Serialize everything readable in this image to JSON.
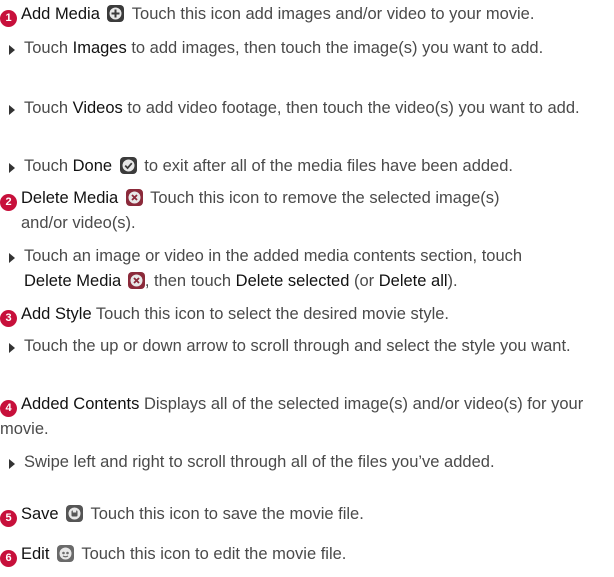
{
  "items": [
    {
      "number": "1",
      "term": "Add Media",
      "description": "Touch this icon add images and/or video to your movie.",
      "icon": "add-media-icon"
    },
    {
      "bullet_a_pre": "Touch ",
      "bullet_a_term": "Images",
      "bullet_a_post": " to add images, then touch the image(s) you want to add."
    },
    {
      "bullet_b_pre": "Touch ",
      "bullet_b_term": "Videos",
      "bullet_b_post": " to add video footage, then touch the video(s) you want to add."
    },
    {
      "bullet_c_pre": "Touch ",
      "bullet_c_term": "Done",
      "bullet_c_post": " to exit after all of the media files have been added.",
      "icon": "done-check-icon"
    }
  ],
  "delete_media": {
    "number": "2",
    "term": "Delete Media",
    "description_line1": "Touch this icon to remove the selected image(s)",
    "description_line2": "and/or video(s).",
    "icon": "delete-media-icon",
    "bullet_pre": "Touch an image or video in the added media contents section, touch",
    "bullet_term1": "Delete Media",
    "bullet_mid": ", then touch ",
    "bullet_term2": "Delete selected",
    "bullet_mid2": " (or ",
    "bullet_term3": "Delete all",
    "bullet_end": ")."
  },
  "add_style": {
    "number": "3",
    "term": "Add Style",
    "description": "Touch this icon to select the desired movie style.",
    "bullet": "Touch the up or down arrow to scroll through and select the style you want."
  },
  "added_contents": {
    "number": "4",
    "term": "Added Contents",
    "description": "Displays all of the selected image(s) and/or video(s) for your movie.",
    "bullet": "Swipe left and right to scroll through all of the files you’ve added."
  },
  "save": {
    "number": "5",
    "term": "Save",
    "description": "Touch this icon to save the movie file.",
    "icon": "save-icon"
  },
  "edit": {
    "number": "6",
    "term": "Edit",
    "description": "Touch this icon to edit the movie file.",
    "icon": "edit-icon"
  },
  "colors": {
    "number_badge": "#c7103b",
    "body_text": "#4a4a4a",
    "term_text": "#111111"
  }
}
